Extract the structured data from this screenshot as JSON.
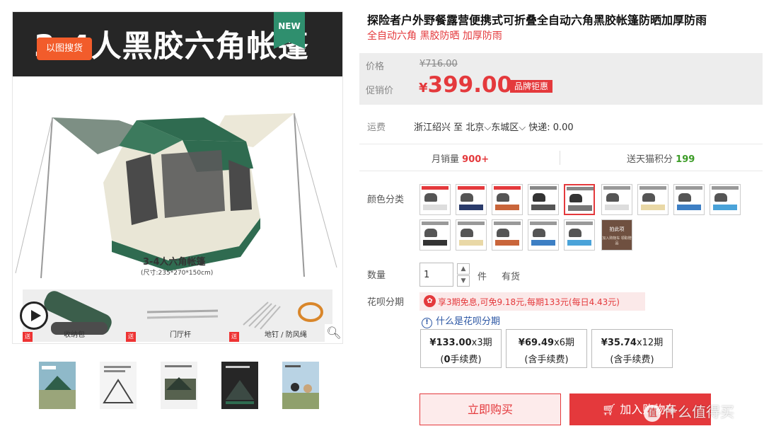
{
  "gallery": {
    "banner_title": "3-4人黑胶六角帐篷",
    "new_badge": "NEW",
    "search_by_image": "以图搜货",
    "tent_caption": "3-4人六角帐篷",
    "tent_size": "(尺寸:235*270*150cm)",
    "accessories": [
      {
        "label": "收纳包",
        "tag": "送"
      },
      {
        "label": "门厅杆",
        "tag": "送"
      },
      {
        "label": "地钉 / 防风绳",
        "tag": "送"
      }
    ],
    "play_icon": "play-icon",
    "zoom_icon": "magnifier-icon",
    "thumbnails": 5
  },
  "product": {
    "title": "探险者户外野餐露营便携式可折叠全自动六角黑胶帐篷防晒加厚防雨",
    "subtitle": "全自动六角  黑胶防晒  加厚防雨"
  },
  "price": {
    "label": "价格",
    "original": "¥716.00",
    "promo_label": "促销价",
    "currency": "¥",
    "promo": "399.00",
    "tag": "品牌钜惠"
  },
  "shipping": {
    "label": "运费",
    "from": "浙江绍兴",
    "to_word": "至",
    "city": "北京",
    "district": "东城区",
    "express": "快递: 0.00"
  },
  "stats": {
    "monthly_sales_label": "月销量",
    "monthly_sales": "900+",
    "points_label": "送天猫积分",
    "points": "199"
  },
  "color": {
    "label": "颜色分类",
    "brown_swatch_title": "拍此项",
    "brown_swatch_sub": "加入购物车 领取赠品"
  },
  "quantity": {
    "label": "数量",
    "value": "1",
    "unit": "件",
    "stock": "有货",
    "up": "▲",
    "down": "▼"
  },
  "huabei": {
    "label": "花呗分期",
    "banner": "享3期免息,可免9.18元,每期133元(每日4.43元)",
    "help": "什么是花呗分期",
    "plans": [
      {
        "amount": "¥133.00",
        "periods": "x3期",
        "fee_pre": "(",
        "fee_bold": "0",
        "fee_post": "手续费)"
      },
      {
        "amount": "¥69.49",
        "periods": "x6期",
        "fee_pre": "(含手续费)",
        "fee_bold": "",
        "fee_post": ""
      },
      {
        "amount": "¥35.74",
        "periods": "x12期",
        "fee_pre": "(含手续费)",
        "fee_bold": "",
        "fee_post": ""
      }
    ]
  },
  "actions": {
    "buy_now": "立即购买",
    "add_cart": "加入购物车"
  },
  "watermark": {
    "text": "什么值得买",
    "logo": "值"
  },
  "colors": {
    "accent": "#e4393c",
    "banner_bg": "#262626",
    "new_badge": "#2f8f6e",
    "search_btn": "#f25c2b",
    "points_green": "#3c9c27",
    "link_blue": "#2a55a3"
  }
}
